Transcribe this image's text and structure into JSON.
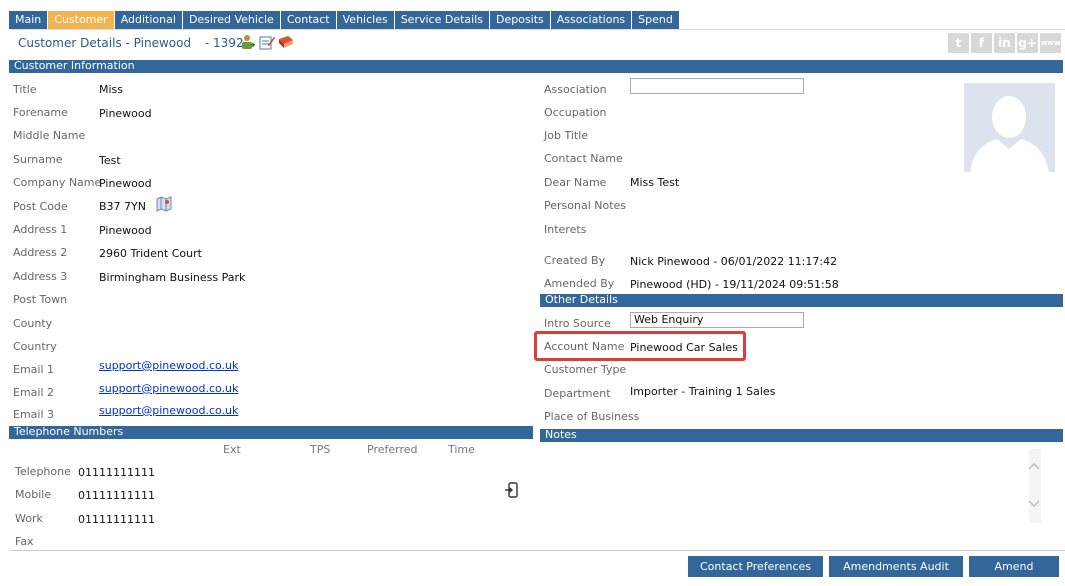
{
  "tabs": [
    "Main",
    "Customer",
    "Additional",
    "Desired Vehicle",
    "Contact",
    "Vehicles",
    "Service Details",
    "Deposits",
    "Associations",
    "Spend"
  ],
  "active_tab": "Customer",
  "header": {
    "title": "Customer Details  - Pinewood",
    "number": "- 1392"
  },
  "social": [
    "t",
    "f",
    "in",
    "g+",
    "www"
  ],
  "sections": {
    "customer_info": "Customer Information",
    "telephone": "Telephone Numbers",
    "other": "Other Details",
    "notes": "Notes"
  },
  "customer": {
    "title_lbl": "Title",
    "title": "Miss",
    "forename_lbl": "Forename",
    "forename": "Pinewood",
    "middle_lbl": "Middle Name",
    "middle": "",
    "surname_lbl": "Surname",
    "surname": "Test",
    "company_lbl": "Company Name",
    "company": "Pinewood",
    "postcode_lbl": "Post Code",
    "postcode": "B37 7YN",
    "addr1_lbl": "Address 1",
    "addr1": "Pinewood",
    "addr2_lbl": "Address 2",
    "addr2": "2960 Trident Court",
    "addr3_lbl": "Address 3",
    "addr3": "Birmingham Business Park",
    "town_lbl": "Post Town",
    "town": "",
    "county_lbl": "County",
    "county": "",
    "country_lbl": "Country",
    "country": "",
    "email1_lbl": "Email 1",
    "email1": "support@pinewood.co.uk",
    "email2_lbl": "Email 2",
    "email2": "support@pinewood.co.uk",
    "email3_lbl": "Email 3",
    "email3": "support@pinewood.co.uk"
  },
  "right": {
    "assoc_lbl": "Association",
    "assoc": "",
    "occupation_lbl": "Occupation",
    "jobtitle_lbl": "Job Title",
    "contact_lbl": "Contact Name",
    "dear_lbl": "Dear Name",
    "dear": "Miss Test",
    "notes_lbl": "Personal Notes",
    "interests_lbl": "Interets",
    "created_lbl": "Created By",
    "created": "Nick Pinewood - 06/01/2022 11:17:42",
    "amended_lbl": "Amended By",
    "amended": "Pinewood (HD) - 19/11/2024 09:51:58"
  },
  "other": {
    "intro_lbl": "Intro Source",
    "intro": "Web Enquiry",
    "account_lbl": "Account Name",
    "account": "Pinewood Car Sales",
    "ctype_lbl": "Customer Type",
    "dept_lbl": "Department",
    "dept": "Importer - Training 1 Sales",
    "place_lbl": "Place of Business"
  },
  "phone": {
    "headers": {
      "ext": "Ext",
      "tps": "TPS",
      "preferred": "Preferred",
      "time": "Time"
    },
    "rows": [
      {
        "label": "Telephone",
        "number": "01111111111"
      },
      {
        "label": "Mobile",
        "number": "01111111111"
      },
      {
        "label": "Work",
        "number": "01111111111"
      },
      {
        "label": "Fax",
        "number": ""
      }
    ]
  },
  "buttons": {
    "contact_pref": "Contact Preferences",
    "amend_audit": "Amendments Audit",
    "amend": "Amend"
  },
  "colors": {
    "bar": "#336699",
    "active_tab": "#f5b452",
    "highlight": "#e03a3a"
  }
}
